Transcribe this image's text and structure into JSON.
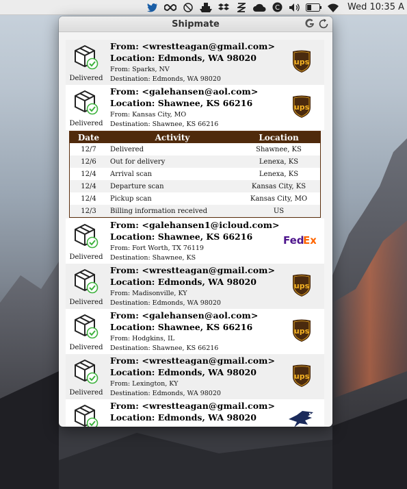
{
  "menubar": {
    "icons": [
      "twitter-icon",
      "infinity-icon",
      "no-entry-icon",
      "ship-icon",
      "dropbox-icon",
      "pen-icon",
      "cloud-icon",
      "c-circle-icon",
      "volume-icon",
      "battery-icon",
      "wifi-icon"
    ],
    "clock": "Wed 10:35 A"
  },
  "window": {
    "title": "Shipmate",
    "buttons": [
      "google-icon",
      "refresh-icon"
    ]
  },
  "packages": [
    {
      "status": "Delivered",
      "from": "From: <wrestteagan@gmail.com>",
      "location": "Location: Edmonds, WA 98020",
      "origin": "From: Sparks, NV",
      "destination": "Destination: Edmonds, WA 98020",
      "carrier": "ups"
    },
    {
      "status": "Delivered",
      "from": "From: <galehansen@aol.com>",
      "location": "Location: Shawnee, KS 66216",
      "origin": "From: Kansas City, MO",
      "destination": "Destination: Shawnee, KS 66216",
      "carrier": "ups"
    },
    {
      "status": "Delivered",
      "from": "From: <galehansen1@icloud.com>",
      "location": "Location: Shawnee, KS 66216",
      "origin": "From: Fort Worth, TX 76119",
      "destination": "Destination: Shawnee, KS",
      "carrier": "fedex"
    },
    {
      "status": "Delivered",
      "from": "From: <wrestteagan@gmail.com>",
      "location": "Location: Edmonds, WA 98020",
      "origin": "From: Madisonville, KY",
      "destination": "Destination: Edmonds, WA 98020",
      "carrier": "ups"
    },
    {
      "status": "Delivered",
      "from": "From: <galehansen@aol.com>",
      "location": "Location: Shawnee, KS 66216",
      "origin": "From: Hodgkins, IL",
      "destination": "Destination: Shawnee, KS 66216",
      "carrier": "ups"
    },
    {
      "status": "Delivered",
      "from": "From: <wrestteagan@gmail.com>",
      "location": "Location: Edmonds, WA 98020",
      "origin": "From: Lexington, KY",
      "destination": "Destination: Edmonds, WA 98020",
      "carrier": "ups"
    },
    {
      "status": "",
      "from": "From: <wrestteagan@gmail.com>",
      "location": "Location: Edmonds, WA 98020",
      "origin": "",
      "destination": "",
      "carrier": "usps"
    }
  ],
  "tracking": {
    "headers": {
      "date": "Date",
      "activity": "Activity",
      "location": "Location"
    },
    "rows": [
      {
        "date": "12/7",
        "activity": "Delivered",
        "location": "Shawnee, KS"
      },
      {
        "date": "12/6",
        "activity": "Out for delivery",
        "location": "Lenexa, KS"
      },
      {
        "date": "12/4",
        "activity": "Arrival scan",
        "location": "Lenexa, KS"
      },
      {
        "date": "12/4",
        "activity": "Departure scan",
        "location": "Kansas City, KS"
      },
      {
        "date": "12/4",
        "activity": "Pickup scan",
        "location": "Kansas City, MO"
      },
      {
        "date": "12/3",
        "activity": "Billing information received",
        "location": "US"
      }
    ]
  },
  "carrier_logos": {
    "ups": "ups",
    "fedex_fed": "Fed",
    "fedex_ex": "Ex"
  },
  "colors": {
    "ups_brown": "#4a2a0e",
    "ups_gold": "#f5b324",
    "track_header": "#4f2a0c",
    "check_green": "#3db23d",
    "fedex_purple": "#4d148c",
    "fedex_orange": "#ff6600"
  }
}
